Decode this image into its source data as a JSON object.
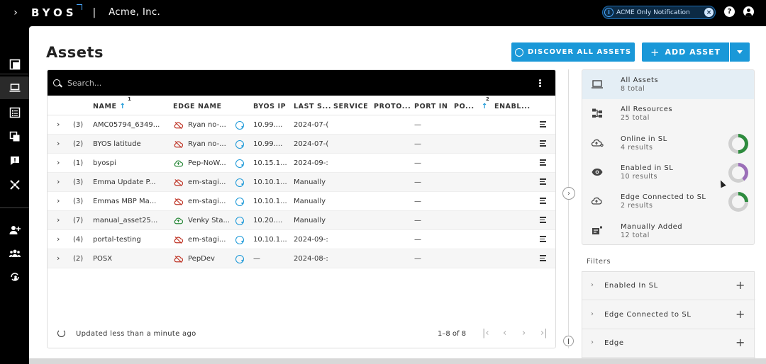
{
  "topbar": {
    "brand": "BYOS",
    "org": "Acme, Inc.",
    "notification": "ACME Only Notification"
  },
  "page": {
    "title": "Assets",
    "discover_label": "DISCOVER ALL ASSETS",
    "add_label": "ADD ASSET"
  },
  "search": {
    "placeholder": "Search..."
  },
  "columns": [
    "NAME",
    "EDGE NAME",
    "BYOS IP",
    "LAST S...",
    "SERVICE",
    "PROTO...",
    "PORT IN",
    "PO...",
    "ENABL..."
  ],
  "sort_badges": [
    "1",
    "2"
  ],
  "rows": [
    {
      "count": "(3)",
      "name": "AMC05794_6349...",
      "edge": "Ryan no-...",
      "edge_status": "offline",
      "ip": "10.99....",
      "last": "2024-07-(",
      "port": "—"
    },
    {
      "count": "(2)",
      "name": "BYOS latitude",
      "edge": "Ryan no-...",
      "edge_status": "offline",
      "ip": "10.99....",
      "last": "2024-07-(",
      "port": "—"
    },
    {
      "count": "(1)",
      "name": "byospi",
      "edge": "Pep-NoW...",
      "edge_status": "online",
      "ip": "10.15.1...",
      "last": "2024-09-:",
      "port": "—"
    },
    {
      "count": "(3)",
      "name": "Emma Update P...",
      "edge": "em-stagi...",
      "edge_status": "offline",
      "ip": "10.10.1...",
      "last": "Manually",
      "port": "—"
    },
    {
      "count": "(3)",
      "name": "Emmas MBP Ma...",
      "edge": "em-stagi...",
      "edge_status": "offline",
      "ip": "10.10.1...",
      "last": "Manually",
      "port": "—"
    },
    {
      "count": "(7)",
      "name": "manual_asset25...",
      "edge": "Venky Sta...",
      "edge_status": "online",
      "ip": "10.20....",
      "last": "Manually",
      "port": "—"
    },
    {
      "count": "(4)",
      "name": "portal-testing",
      "edge": "em-stagi...",
      "edge_status": "offline",
      "ip": "10.10.1...",
      "last": "2024-09-:",
      "port": "—"
    },
    {
      "count": "(2)",
      "name": "POSX",
      "edge": "PepDev",
      "edge_status": "offline",
      "ip": "—",
      "last": "2024-08-:",
      "port": "—"
    }
  ],
  "footer": {
    "updated": "Updated less than a minute ago",
    "range": "1–8 of 8"
  },
  "summary": [
    {
      "title": "All Assets",
      "sub": "8 total",
      "icon": "laptop-icon"
    },
    {
      "title": "All Resources",
      "sub": "25 total",
      "icon": "resources-icon"
    },
    {
      "title": "Online in SL",
      "sub": "4 results",
      "icon": "cloud-icon",
      "donut": {
        "fraction": 0.5,
        "color": "#2e8b3e"
      }
    },
    {
      "title": "Enabled in SL",
      "sub": "10 results",
      "icon": "eye-icon",
      "donut": {
        "fraction": 0.4,
        "color": "#9b6fb8"
      }
    },
    {
      "title": "Edge Connected to SL",
      "sub": "2 results",
      "icon": "cloud-link-icon",
      "donut": {
        "fraction": 0.25,
        "color": "#2e8b3e"
      }
    },
    {
      "title": "Manually Added",
      "sub": "12 total",
      "icon": "manual-icon"
    }
  ],
  "filters": {
    "label": "Filters",
    "items": [
      "Enabled In SL",
      "Edge Connected to SL",
      "Edge"
    ]
  },
  "colors": {
    "accent": "#1a98d8",
    "offline": "#c0392b",
    "online": "#2e8b3e"
  }
}
